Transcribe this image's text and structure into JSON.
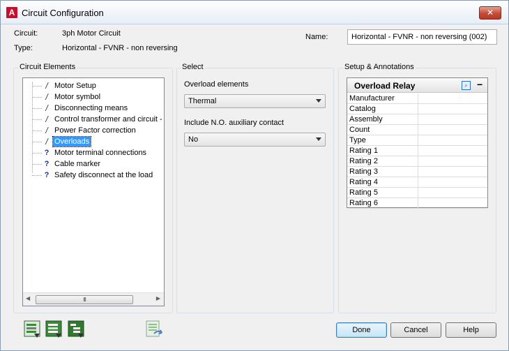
{
  "window": {
    "title": "Circuit Configuration",
    "close_glyph": "✕"
  },
  "info": {
    "circuit_label": "Circuit:",
    "circuit_value": "3ph Motor Circuit",
    "type_label": "Type:",
    "type_value": "Horizontal - FVNR - non reversing",
    "name_label": "Name:",
    "name_value": "Horizontal - FVNR - non reversing (002)"
  },
  "circuit_elements": {
    "group_label": "Circuit Elements",
    "items": [
      {
        "label": "Motor Setup",
        "icon": "pencil-icon",
        "glyph": "/"
      },
      {
        "label": "Motor symbol",
        "icon": "pencil-icon",
        "glyph": "/"
      },
      {
        "label": "Disconnecting means",
        "icon": "pencil-icon",
        "glyph": "/"
      },
      {
        "label": "Control transformer and circuit - no",
        "icon": "pencil-icon",
        "glyph": "/"
      },
      {
        "label": "Power Factor correction",
        "icon": "pencil-icon",
        "glyph": "/"
      },
      {
        "label": "Overloads",
        "icon": "pencil-icon",
        "glyph": "/",
        "selected": true
      },
      {
        "label": "Motor terminal connections",
        "icon": "question-icon",
        "glyph": "?"
      },
      {
        "label": "Cable marker",
        "icon": "question-icon",
        "glyph": "?"
      },
      {
        "label": "Safety disconnect at the load",
        "icon": "question-icon",
        "glyph": "?"
      }
    ],
    "scroll_grip": "III",
    "scroll_left": "◀",
    "scroll_right": "▶"
  },
  "select": {
    "group_label": "Select",
    "overload_label": "Overload elements",
    "overload_value": "Thermal",
    "aux_label": "Include N.O. auxiliary contact",
    "aux_value": "No"
  },
  "setup": {
    "group_label": "Setup & Annotations",
    "header": "Overload Relay",
    "find_glyph": "⌕",
    "collapse_glyph": "−",
    "rows": [
      "Manufacturer",
      "Catalog",
      "Assembly",
      "Count",
      "Type",
      "Rating 1",
      "Rating 2",
      "Rating 3",
      "Rating 4",
      "Rating 5",
      "Rating 6"
    ]
  },
  "buttons": {
    "done": "Done",
    "cancel": "Cancel",
    "help": "Help"
  },
  "colors": {
    "selection": "#3399ff",
    "question_icon": "#1a2ea8",
    "toolbar_icon_green": "#3a8a3a"
  }
}
